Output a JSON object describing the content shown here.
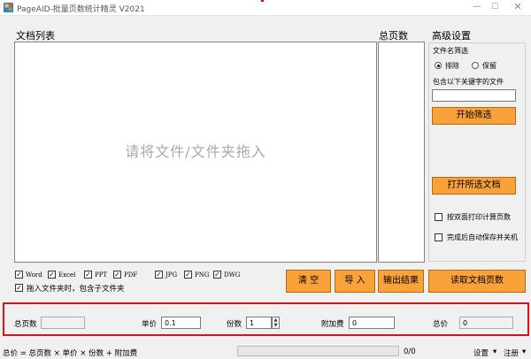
{
  "window": {
    "title": "PageAID-批量页数统计精灵 V2021",
    "min_glyph": "—",
    "max_glyph": "☐",
    "close_glyph": "✕"
  },
  "doc_list": {
    "header": "文档列表",
    "drop_hint": "请将文件/文件夹拖入"
  },
  "page_count_column": {
    "header": "总页数"
  },
  "advanced": {
    "header": "高级设置",
    "filter_label": "文件名筛选",
    "radio_exclude": "排除",
    "radio_keep": "保留",
    "keyword_label": "包含以下关键字的文件",
    "keyword_value": "",
    "start_filter_button": "开始筛选",
    "open_selected_button": "打开所选文档",
    "duplex_label": "按双面打印计算页数",
    "autosave_label": "完成后自动保存并关机"
  },
  "filetypes": [
    {
      "label": "Word",
      "checked": true
    },
    {
      "label": "Excel",
      "checked": true
    },
    {
      "label": "PPT",
      "checked": true
    },
    {
      "label": "PDF",
      "checked": true
    },
    {
      "label": "JPG",
      "checked": true
    },
    {
      "label": "PNG",
      "checked": true
    },
    {
      "label": "DWG",
      "checked": true
    }
  ],
  "include_subfolders": {
    "label": "拖入文件夹时，包含子文件夹",
    "checked": true
  },
  "actions": {
    "clear": "清  空",
    "import": "导  入",
    "export": "输出结果",
    "read_pages": "读取文档页数"
  },
  "pricing": {
    "total_pages_label": "总页数",
    "total_pages_value": "",
    "unit_price_label": "单价",
    "unit_price_value": "0.1",
    "copies_label": "份数",
    "copies_value": "1",
    "surcharge_label": "附加费",
    "surcharge_value": "0",
    "total_price_label": "总价",
    "total_price_value": "0"
  },
  "status": {
    "formula": "总价 = 总页数 × 单价 × 份数 + 附加费",
    "progress_text": "0/0",
    "progress": 0,
    "settings_menu": "设置",
    "register_menu": "注册",
    "dropdown_glyph": "▾"
  },
  "colors": {
    "accent_orange": "#f9a23a",
    "highlight_red": "#d81414"
  }
}
